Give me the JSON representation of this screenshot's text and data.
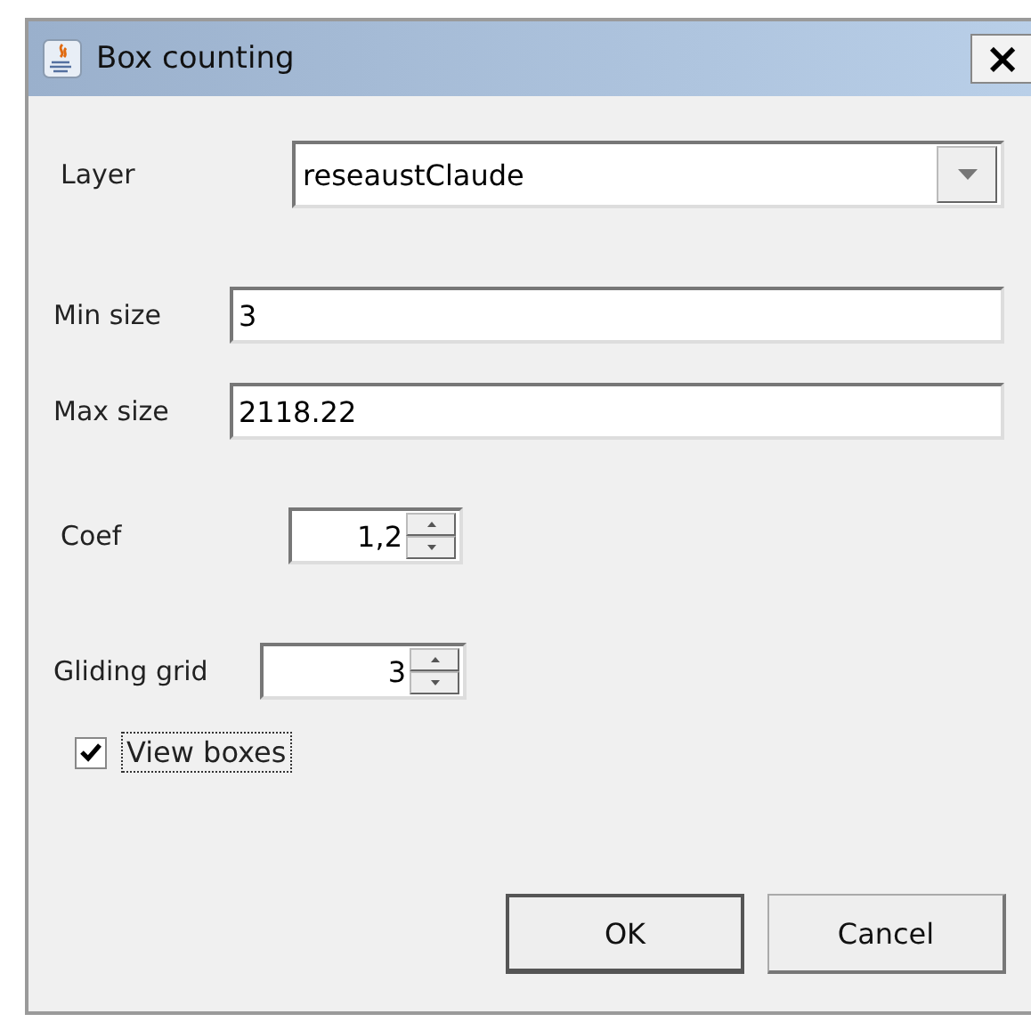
{
  "window": {
    "title": "Box counting",
    "close": "×"
  },
  "layer": {
    "label": "Layer",
    "value": "reseaustClaude"
  },
  "min_size": {
    "label": "Min size",
    "value": "3"
  },
  "max_size": {
    "label": "Max size",
    "value": "2118.22"
  },
  "coef": {
    "label": "Coef",
    "value": "1,2"
  },
  "gliding_grid": {
    "label": "Gliding grid",
    "value": "3"
  },
  "view_boxes": {
    "label": "View boxes",
    "checked": true,
    "focused": true
  },
  "buttons": [
    {
      "label": "OK",
      "default": true
    },
    {
      "label": "Cancel",
      "default": false
    }
  ]
}
